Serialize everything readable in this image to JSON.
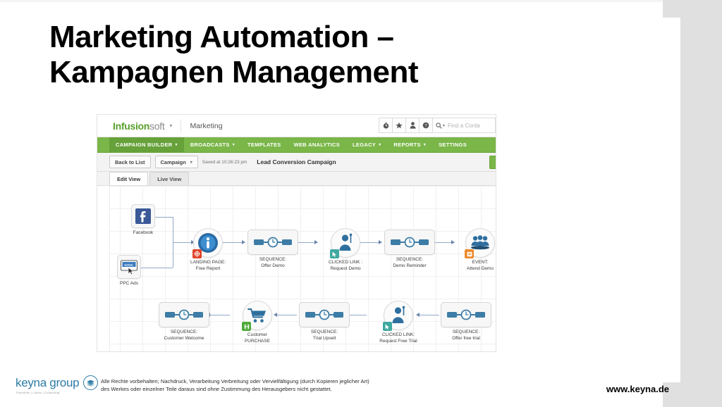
{
  "slide": {
    "title_line1": "Marketing Automation –",
    "title_line2": "Kampagnen Management"
  },
  "app": {
    "logo": {
      "part1": "Infusion",
      "part2": "soft",
      "caret": "▾"
    },
    "section": "Marketing",
    "header_icons": [
      "clock-icon",
      "star-icon",
      "person-icon",
      "help-icon"
    ],
    "search": {
      "placeholder": "Find a Conta",
      "icon": "search-icon",
      "caret": "▾"
    },
    "nav": [
      {
        "label": "CAMPAIGN BUILDER",
        "caret": "▾",
        "active": true
      },
      {
        "label": "BROADCASTS",
        "caret": "▾",
        "active": false
      },
      {
        "label": "TEMPLATES",
        "caret": "",
        "active": false
      },
      {
        "label": "WEB ANALYTICS",
        "caret": "",
        "active": false
      },
      {
        "label": "LEGACY",
        "caret": "▾",
        "active": false
      },
      {
        "label": "REPORTS",
        "caret": "▾",
        "active": false
      },
      {
        "label": "SETTINGS",
        "caret": "",
        "active": false
      }
    ],
    "toolbar": {
      "back_label": "Back to List",
      "campaign_label": "Campaign",
      "campaign_caret": "▾",
      "saved_text": "Saved at 10:26:23 pm",
      "campaign_title": "Lead Conversion Campaign"
    },
    "view_tabs": [
      {
        "label": "Edit View",
        "active": true
      },
      {
        "label": "Live View",
        "active": false
      }
    ],
    "nodes": [
      {
        "id": "facebook",
        "icon": "facebook-icon",
        "line1": "Facebook",
        "line2": ""
      },
      {
        "id": "ppc-ads",
        "icon": "web-page-icon",
        "line1": "PPC Ads",
        "line2": ""
      },
      {
        "id": "landing-page",
        "icon": "info-icon",
        "line1": "LANDING PAGE:",
        "line2": "Free Report"
      },
      {
        "id": "seq-offer-demo",
        "icon": "sequence-icon",
        "line1": "SEQUENCE:",
        "line2": "Offer Demo"
      },
      {
        "id": "clicked-request-demo",
        "icon": "clicked-link-icon",
        "line1": "CLICKED LINK :",
        "line2": "Request Demo"
      },
      {
        "id": "seq-demo-reminder",
        "icon": "sequence-icon",
        "line1": "SEQUENCE:",
        "line2": "Demo Reminder"
      },
      {
        "id": "event-attend-demo",
        "icon": "event-icon",
        "line1": "EVENT:",
        "line2": "Attend Demo"
      },
      {
        "id": "seq-offer-free-trial",
        "icon": "sequence-icon",
        "line1": "SEQUENCE:",
        "line2": "Offer free trial"
      },
      {
        "id": "clicked-free-trial",
        "icon": "clicked-link-icon",
        "line1": "CLICKED LINK:",
        "line2": "Request Free Trial"
      },
      {
        "id": "seq-trial-upsell",
        "icon": "sequence-icon",
        "line1": "SEQUENCE:",
        "line2": "Trial Upsell"
      },
      {
        "id": "customer-purchase",
        "icon": "cart-icon",
        "line1": "Customer",
        "line2": "PURCHASE"
      },
      {
        "id": "seq-customer-welcome",
        "icon": "sequence-icon",
        "line1": "SEQUENCE:",
        "line2": "Customer Welcome"
      }
    ]
  },
  "footer": {
    "logo_name": "keyna group",
    "logo_tagline": "Franchise | Lizenz | Consulting",
    "legal_line1": "Alle Rechte vorbehalten; Nachdruck, Verarbeitung Verbreitung oder Vervielfältigung (durch Kopieren jeglicher Art)",
    "legal_line2": "des Werkes oder einzelner Teile daraus sind ohne Zustimmung des Herausgebers nicht gestattet.",
    "url": "www.keyna.de"
  },
  "colors": {
    "brand_green": "#7ab648",
    "logo_green": "#5aa02c",
    "keyna_blue": "#2e7ca6",
    "connector": "#93a8c8",
    "slide_band": "#e0e0e0"
  }
}
